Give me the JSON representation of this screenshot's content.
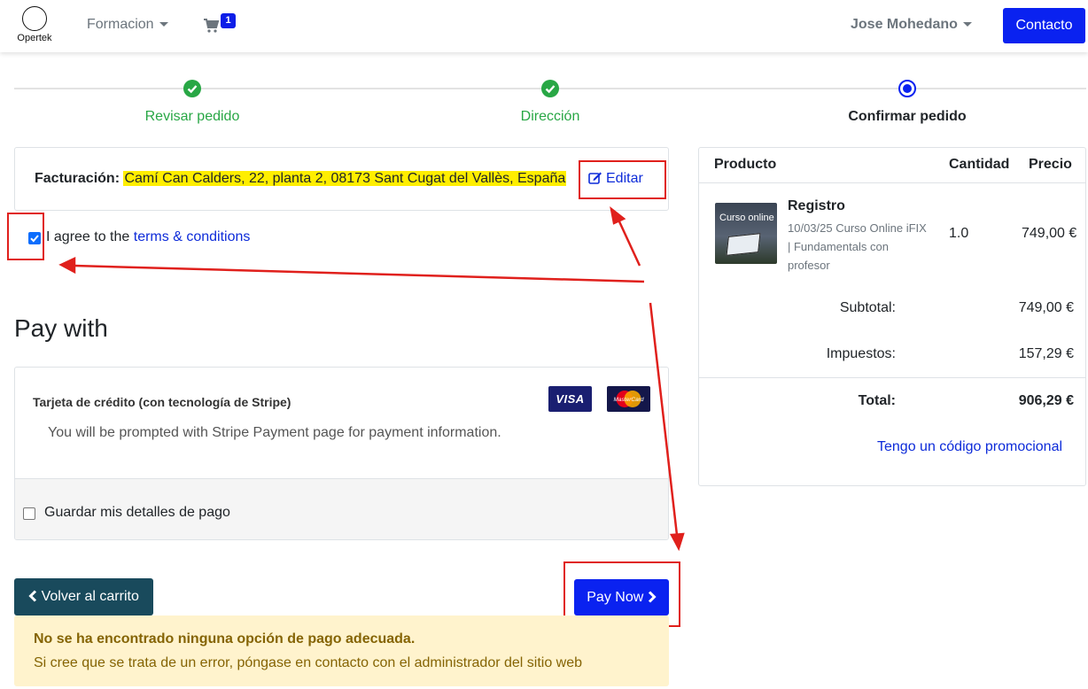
{
  "navbar": {
    "logo_text": "Opertek",
    "menu_formacion": "Formacion",
    "cart_count": "1",
    "user_name": "Jose Mohedano",
    "contact_button": "Contacto"
  },
  "steps": [
    {
      "label": "Revisar pedido",
      "status": "done"
    },
    {
      "label": "Dirección",
      "status": "done"
    },
    {
      "label": "Confirmar pedido",
      "status": "current"
    }
  ],
  "billing": {
    "label": "Facturación:",
    "address": "Camí Can Calders, 22, planta 2, 08173 Sant Cugat del Vallès, España",
    "edit_label": "Editar"
  },
  "terms": {
    "checked": true,
    "prefix": "I agree to the",
    "link": "terms & conditions"
  },
  "payment": {
    "heading": "Pay with",
    "method_title": "Tarjeta de crédito (con tecnología de Stripe)",
    "method_desc": "You will be prompted with Stripe Payment page for payment information.",
    "card_visa": "VISA",
    "card_mastercard": "MasterCard",
    "save_details": "Guardar mis detalles de pago"
  },
  "actions": {
    "back_label": "Volver al carrito",
    "pay_label": "Pay Now"
  },
  "alert": {
    "title": "No se ha encontrado ninguna opción de pago adecuada.",
    "message": "Si cree que se trata de un error, póngase en contacto con el administrador del sitio web"
  },
  "summary": {
    "headers": {
      "product": "Producto",
      "quantity": "Cantidad",
      "price": "Precio"
    },
    "item": {
      "thumb_label": "Curso online",
      "name": "Registro",
      "description": "10/03/25 Curso Online iFIX | Fundamentals con profesor",
      "quantity": "1.0",
      "price": "749,00 €"
    },
    "subtotal_label": "Subtotal:",
    "subtotal_value": "749,00 €",
    "tax_label": "Impuestos:",
    "tax_value": "157,29 €",
    "total_label": "Total:",
    "total_value": "906,29 €",
    "promo_link": "Tengo un código promocional"
  },
  "colors": {
    "primary": "#0a22f0",
    "success": "#28a745",
    "annotation_red": "#e0201c",
    "highlight": "#ffee00"
  }
}
